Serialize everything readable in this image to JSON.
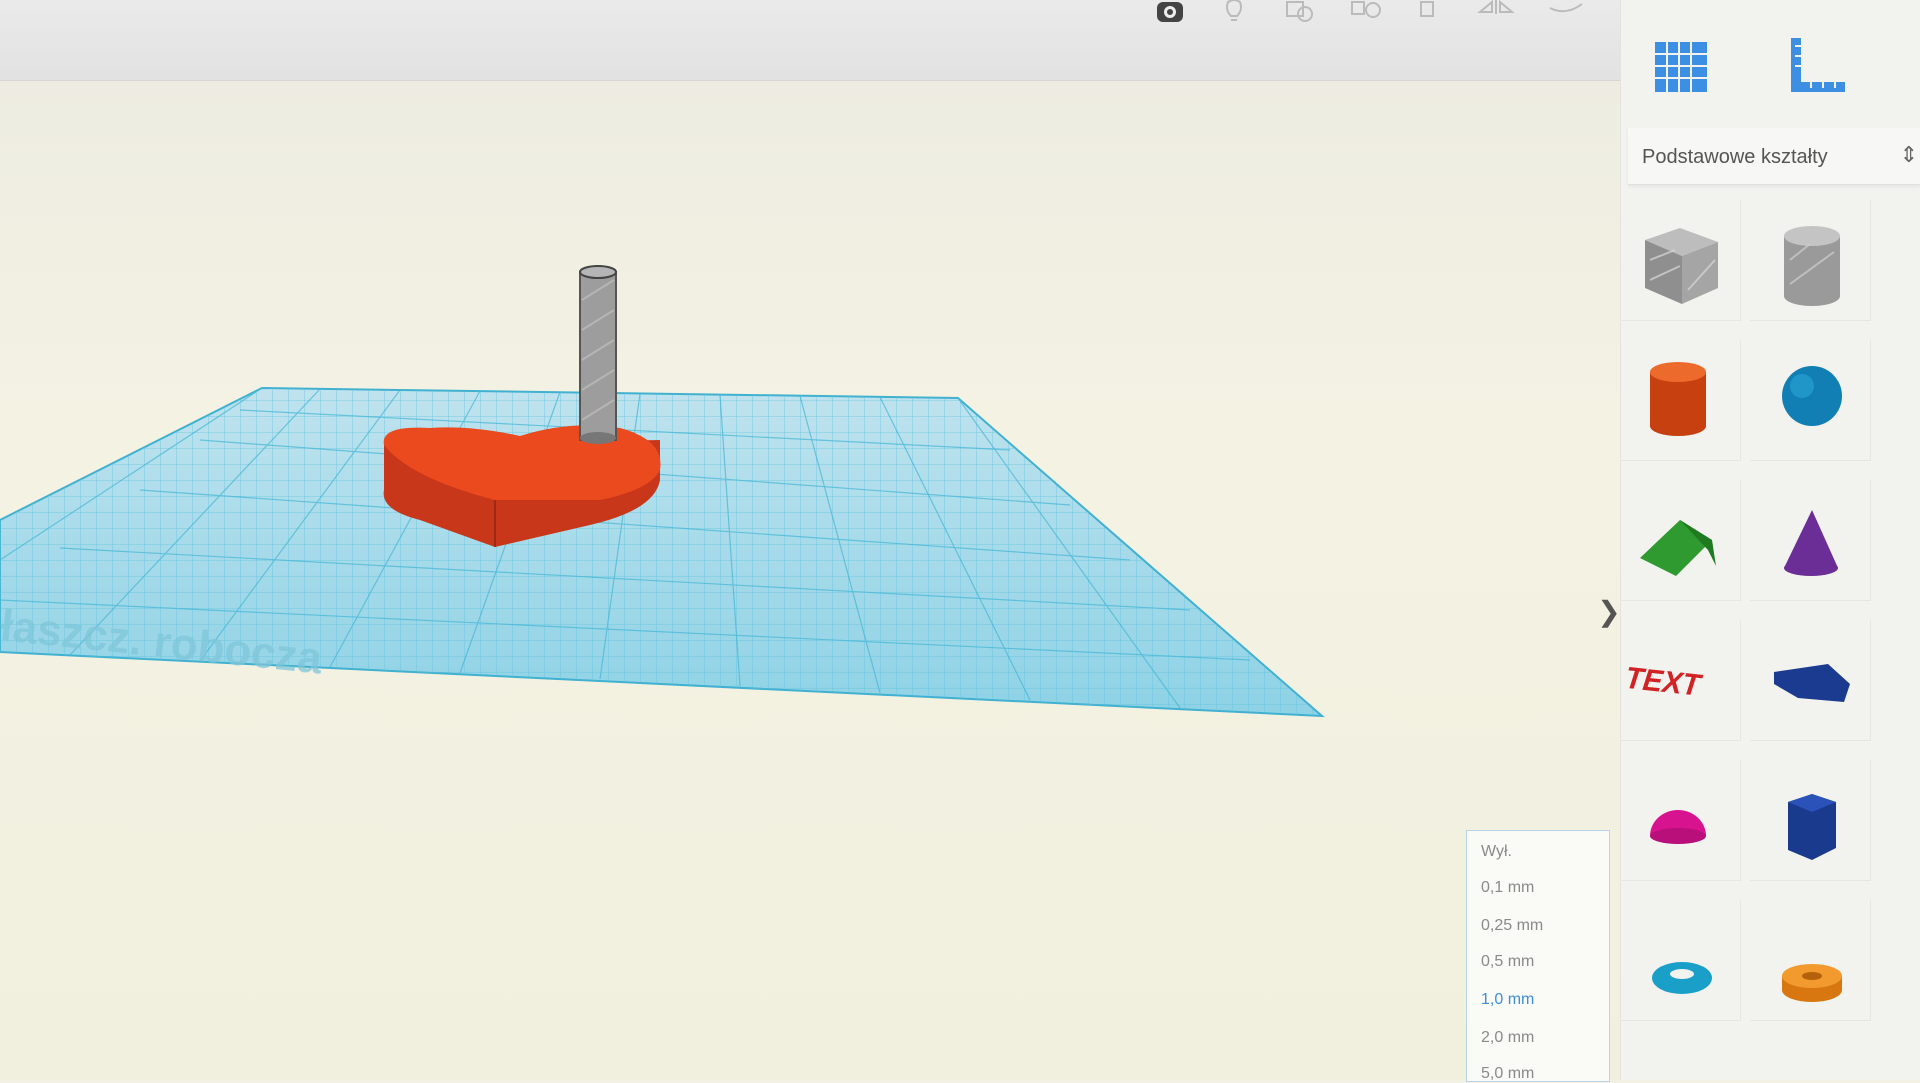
{
  "workplane": {
    "label": "Płaszcz. robocza",
    "grid_color": "#3fb3d3"
  },
  "toolbar": {
    "icons": [
      "camera-icon",
      "lightbulb-icon",
      "group-icon",
      "ungroup-icon",
      "align-icon",
      "mirror-icon",
      "handle-icon"
    ]
  },
  "panel": {
    "workplane_tool_icon": "workplane-grid-icon",
    "ruler_tool_icon": "ruler-icon",
    "category_label": "Podstawowe kształty",
    "category_arrow": "⇕",
    "collapse_symbol": "❯",
    "shapes": [
      {
        "name": "box-hole",
        "color": "#9a9a9a"
      },
      {
        "name": "cylinder-hole",
        "color": "#9a9a9a"
      },
      {
        "name": "cylinder",
        "color": "#e0521b"
      },
      {
        "name": "sphere",
        "color": "#1a8ec2"
      },
      {
        "name": "roof",
        "color": "#3aa336"
      },
      {
        "name": "cone",
        "color": "#7a3aa6"
      },
      {
        "name": "text",
        "color": "#d6272b"
      },
      {
        "name": "wedge",
        "color": "#1f3f9a"
      },
      {
        "name": "half-sphere",
        "color": "#e0219b"
      },
      {
        "name": "polygon",
        "color": "#1f3f9a"
      },
      {
        "name": "torus",
        "color": "#1aa0c8"
      },
      {
        "name": "tube",
        "color": "#ec8a1e"
      }
    ],
    "text_shape_label": "TEXT"
  },
  "snap_grid": {
    "options": [
      "Wył.",
      "0,1 mm",
      "0,25 mm",
      "0,5 mm",
      "1,0 mm",
      "2,0 mm",
      "5,0 mm"
    ],
    "selected": "1,0 mm"
  },
  "scene": {
    "heart_color": "#e8491c",
    "hole_color": "#9e9e9e"
  }
}
